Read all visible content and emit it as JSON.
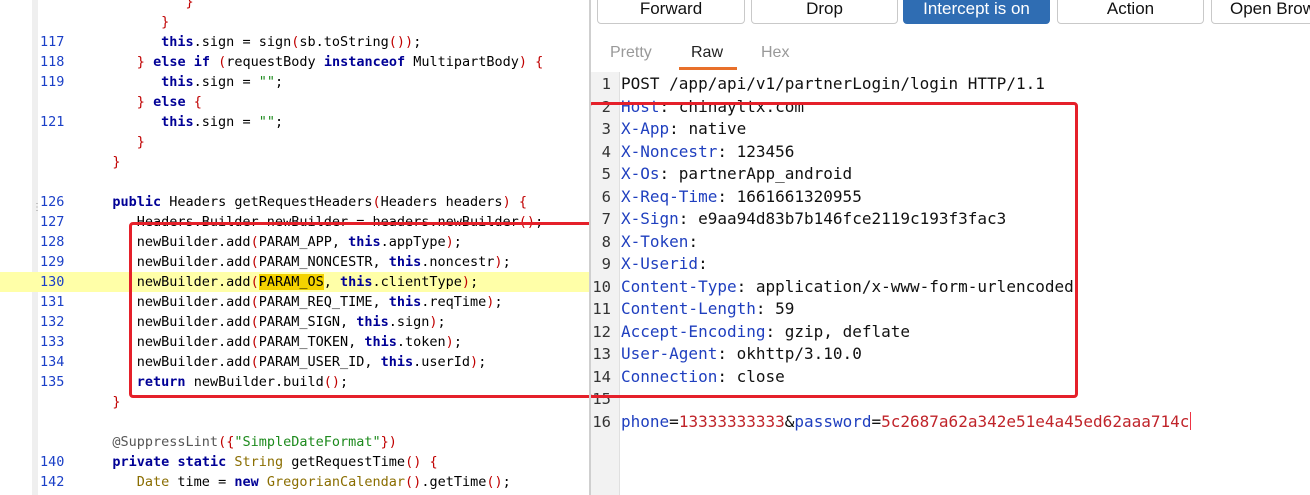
{
  "code_editor": {
    "lines": [
      {
        "n": "",
        "t": "            }"
      },
      {
        "n": "",
        "t": "         }"
      },
      {
        "n": "117",
        "t": "         this.sign = sign(sb.toString());"
      },
      {
        "n": "118",
        "t": "      } else if (requestBody instanceof MultipartBody) {"
      },
      {
        "n": "119",
        "t": "         this.sign = \"\";"
      },
      {
        "n": "",
        "t": "      } else {"
      },
      {
        "n": "121",
        "t": "         this.sign = \"\";"
      },
      {
        "n": "",
        "t": "      }"
      },
      {
        "n": "",
        "t": "   }"
      },
      {
        "n": "",
        "t": ""
      },
      {
        "n": "126",
        "t": "   public Headers getRequestHeaders(Headers headers) {"
      },
      {
        "n": "127",
        "t": "      Headers.Builder newBuilder = headers.newBuilder();"
      },
      {
        "n": "128",
        "t": "      newBuilder.add(PARAM_APP, this.appType);"
      },
      {
        "n": "129",
        "t": "      newBuilder.add(PARAM_NONCESTR, this.noncestr);"
      },
      {
        "n": "130",
        "t": "      newBuilder.add(PARAM_OS, this.clientType);"
      },
      {
        "n": "131",
        "t": "      newBuilder.add(PARAM_REQ_TIME, this.reqTime);"
      },
      {
        "n": "132",
        "t": "      newBuilder.add(PARAM_SIGN, this.sign);"
      },
      {
        "n": "133",
        "t": "      newBuilder.add(PARAM_TOKEN, this.token);"
      },
      {
        "n": "134",
        "t": "      newBuilder.add(PARAM_USER_ID, this.userId);"
      },
      {
        "n": "135",
        "t": "      return newBuilder.build();"
      },
      {
        "n": "",
        "t": "   }"
      },
      {
        "n": "",
        "t": ""
      },
      {
        "n": "",
        "t": "   @SuppressLint({\"SimpleDateFormat\"})"
      },
      {
        "n": "140",
        "t": "   private static String getRequestTime() {"
      },
      {
        "n": "142",
        "t": "      Date time = new GregorianCalendar().getTime();"
      }
    ],
    "highlighted_line": "130",
    "selected_word": "PARAM_OS"
  },
  "toolbar": {
    "forward_label": "Forward",
    "drop_label": "Drop",
    "intercept_label": "Intercept is on",
    "action_label": "Action",
    "open_browser_label": "Open Brow"
  },
  "view_tabs": {
    "pretty": "Pretty",
    "raw": "Raw",
    "hex": "Hex",
    "active": "Raw"
  },
  "request": {
    "lines": [
      {
        "n": "1",
        "k": "",
        "v": "POST /app/api/v1/partnerLogin/login HTTP/1.1"
      },
      {
        "n": "2",
        "k": "Host",
        "v": "chinayltx.com"
      },
      {
        "n": "3",
        "k": "X-App",
        "v": "native"
      },
      {
        "n": "4",
        "k": "X-Noncestr",
        "v": "123456"
      },
      {
        "n": "5",
        "k": "X-Os",
        "v": "partnerApp_android"
      },
      {
        "n": "6",
        "k": "X-Req-Time",
        "v": "1661661320955"
      },
      {
        "n": "7",
        "k": "X-Sign",
        "v": "e9aa94d83b7b146fce2119c193f3fac3"
      },
      {
        "n": "8",
        "k": "X-Token",
        "v": ""
      },
      {
        "n": "9",
        "k": "X-Userid",
        "v": ""
      },
      {
        "n": "10",
        "k": "Content-Type",
        "v": "application/x-www-form-urlencoded"
      },
      {
        "n": "11",
        "k": "Content-Length",
        "v": "59"
      },
      {
        "n": "12",
        "k": "Accept-Encoding",
        "v": "gzip, deflate"
      },
      {
        "n": "13",
        "k": "User-Agent",
        "v": "okhttp/3.10.0"
      },
      {
        "n": "14",
        "k": "Connection",
        "v": "close"
      },
      {
        "n": "15",
        "k": "",
        "v": ""
      }
    ],
    "body_line_number": "16",
    "body_params": [
      {
        "key": "phone",
        "value": "13333333333"
      },
      {
        "key": "password",
        "value": "5c2687a62a342e51e4a45ed62aaa714c"
      }
    ]
  },
  "colors": {
    "annotation_box": "#e5202a",
    "intercept_button": "#2f6db3",
    "active_tab_underline": "#e8702a",
    "line_highlight": "#ffffa8",
    "header_key": "#1f3fbf",
    "param_value": "#c0242a"
  }
}
